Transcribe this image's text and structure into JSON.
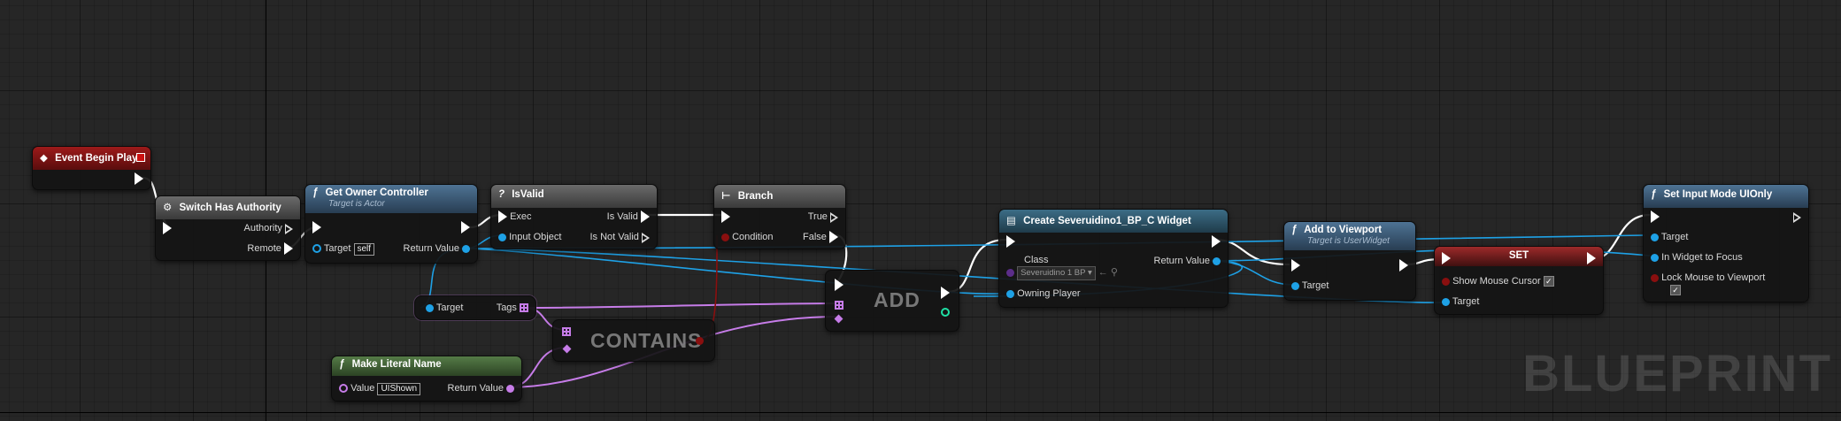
{
  "graph": {
    "watermark": "BLUEPRINT"
  },
  "colors": {
    "exec": "#ffffff",
    "object": "#1ea1e6",
    "name": "#c67ce8",
    "bool": "#8a0f0f",
    "integer": "#1fe0a5"
  },
  "nodes": {
    "event_begin_play": {
      "title": "Event Begin Play"
    },
    "switch_authority": {
      "title": "Switch Has Authority",
      "pins": {
        "authority": "Authority",
        "remote": "Remote"
      }
    },
    "get_owner_controller": {
      "title": "Get Owner Controller",
      "subtitle": "Target is Actor",
      "pins": {
        "target": "Target",
        "target_value": "self",
        "return": "Return Value"
      }
    },
    "is_valid": {
      "title": "IsValid",
      "pins": {
        "exec": "Exec",
        "input_object": "Input Object",
        "is_valid": "Is Valid",
        "is_not_valid": "Is Not Valid"
      }
    },
    "branch": {
      "title": "Branch",
      "pins": {
        "condition": "Condition",
        "true": "True",
        "false": "False"
      }
    },
    "create_widget": {
      "title": "Create Severuidino1_BP_C Widget",
      "pins": {
        "class": "Class",
        "class_value": "Severuidino 1 BP",
        "owning_player": "Owning Player",
        "return": "Return Value"
      }
    },
    "add_to_viewport": {
      "title": "Add to Viewport",
      "subtitle": "Target is UserWidget",
      "pins": {
        "target": "Target"
      }
    },
    "set": {
      "title": "SET",
      "pins": {
        "show_mouse_cursor": "Show Mouse Cursor",
        "target": "Target"
      }
    },
    "set_input_mode": {
      "title": "Set Input Mode UIOnly",
      "pins": {
        "target": "Target",
        "widget_to_focus": "In Widget to Focus",
        "lock_mouse": "Lock Mouse to Viewport"
      }
    },
    "get_tags": {
      "pins": {
        "target": "Target",
        "tags": "Tags"
      }
    },
    "add": {
      "title": "ADD"
    },
    "contains": {
      "title": "CONTAINS"
    },
    "make_literal_name": {
      "title": "Make Literal Name",
      "pins": {
        "value": "Value",
        "value_text": "UIShown",
        "return": "Return Value"
      }
    }
  }
}
